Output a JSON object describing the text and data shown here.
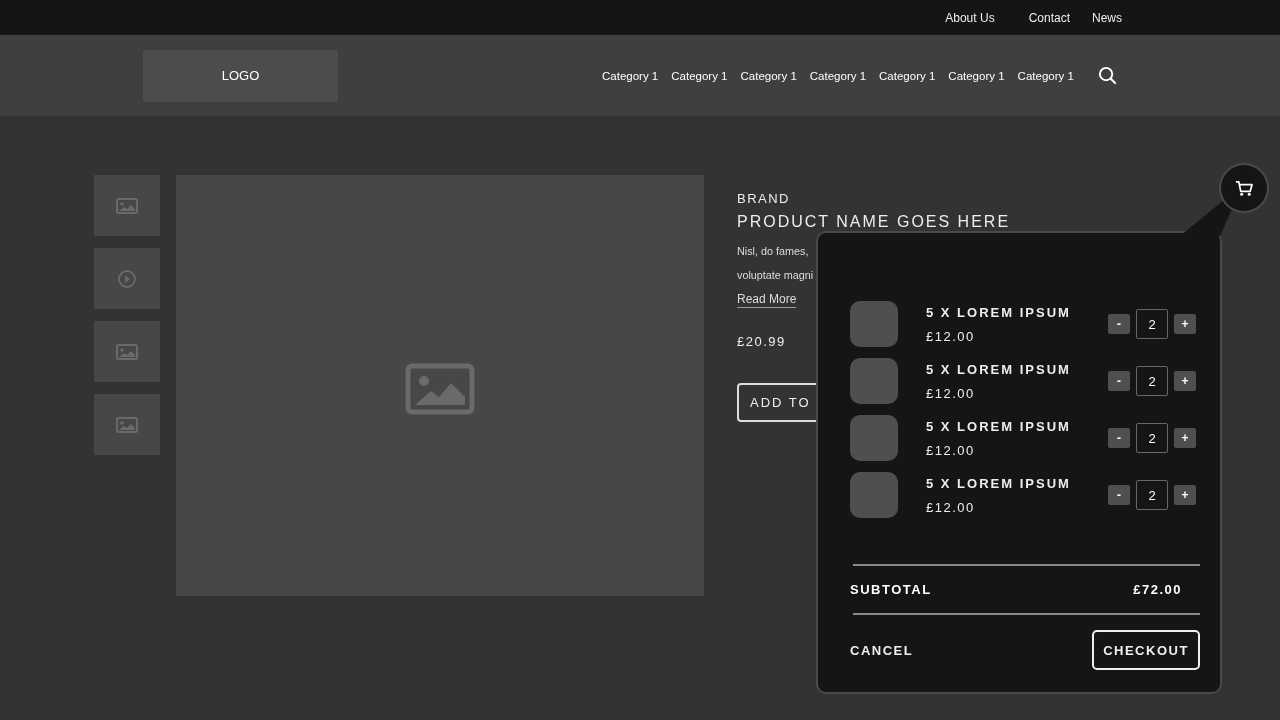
{
  "top_links": [
    "About Us",
    "Contact",
    "News"
  ],
  "logo": "LOGO",
  "categories": [
    "Category 1",
    "Category 1",
    "Category 1",
    "Category 1",
    "Category 1",
    "Category 1",
    "Category 1"
  ],
  "thumbnails": [
    {
      "kind": "image"
    },
    {
      "kind": "video"
    },
    {
      "kind": "image"
    },
    {
      "kind": "image"
    }
  ],
  "product": {
    "brand": "BRAND",
    "name": "PRODUCT NAME GOES HERE",
    "description": [
      "Nisl, do fames,",
      "voluptate magni"
    ],
    "read_more": "Read More",
    "price": "£20.99",
    "add_button": "ADD TO"
  },
  "cart": {
    "items": [
      {
        "name": "5 X LOREM IPSUM",
        "price": "£12.00",
        "quantity": "2"
      },
      {
        "name": "5 X LOREM IPSUM",
        "price": "£12.00",
        "quantity": "2"
      },
      {
        "name": "5 X LOREM IPSUM",
        "price": "£12.00",
        "quantity": "2"
      },
      {
        "name": "5 X LOREM IPSUM",
        "price": "£12.00",
        "quantity": "2"
      }
    ],
    "minus": "-",
    "plus": "+",
    "subtotal_label": "SUBTOTAL",
    "subtotal": "£72.00",
    "cancel": "CANCEL",
    "checkout": "CHECKOUT"
  }
}
